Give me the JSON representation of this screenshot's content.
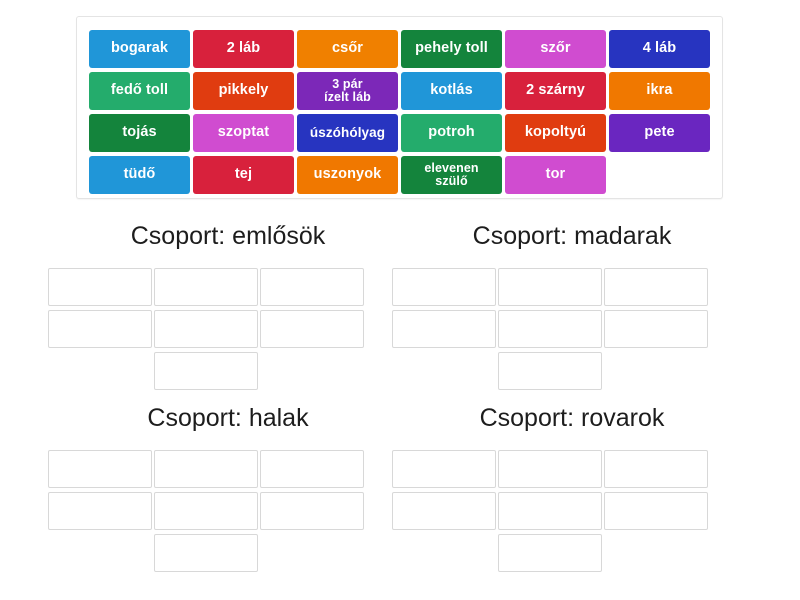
{
  "word_bank": {
    "tiles": [
      {
        "label": "bogarak",
        "color": "#2096d8",
        "lines": 1
      },
      {
        "label": "2 láb",
        "color": "#d8213c",
        "lines": 1
      },
      {
        "label": "csőr",
        "color": "#f08000",
        "lines": 1
      },
      {
        "label": "pehely toll",
        "color": "#14843c",
        "lines": 1
      },
      {
        "label": "szőr",
        "color": "#d04cd0",
        "lines": 1
      },
      {
        "label": "4 láb",
        "color": "#2734c0",
        "lines": 1
      },
      {
        "label": "fedő toll",
        "color": "#24ac6c",
        "lines": 1
      },
      {
        "label": "pikkely",
        "color": "#e03c10",
        "lines": 1
      },
      {
        "label": "3 pár ízelt láb",
        "color": "#7c28b8",
        "lines": 2,
        "line1": "3 pár",
        "line2": "ízelt láb"
      },
      {
        "label": "kotlás",
        "color": "#2096d8",
        "lines": 1
      },
      {
        "label": "2 szárny",
        "color": "#d8213c",
        "lines": 1
      },
      {
        "label": "ikra",
        "color": "#f07800",
        "lines": 1
      },
      {
        "label": "tojás",
        "color": "#14843c",
        "lines": 1
      },
      {
        "label": "szoptat",
        "color": "#d04cd0",
        "lines": 1
      },
      {
        "label": "úszóhólyag",
        "color": "#2734c0",
        "lines": 1,
        "shrink": true
      },
      {
        "label": "potroh",
        "color": "#24ac6c",
        "lines": 1
      },
      {
        "label": "kopoltyú",
        "color": "#e03c10",
        "lines": 1
      },
      {
        "label": "pete",
        "color": "#6a26c0",
        "lines": 1
      },
      {
        "label": "tüdő",
        "color": "#2096d8",
        "lines": 1
      },
      {
        "label": "tej",
        "color": "#d8213c",
        "lines": 1
      },
      {
        "label": "uszonyok",
        "color": "#f07800",
        "lines": 1
      },
      {
        "label": "elevenen szülő",
        "color": "#14843c",
        "lines": 2,
        "line1": "elevenen",
        "line2": "szülő"
      },
      {
        "label": "tor",
        "color": "#d04cd0",
        "lines": 1
      },
      {
        "label": "",
        "color": "transparent",
        "lines": 0
      }
    ]
  },
  "groups": [
    {
      "title": "Csoport: emlősök",
      "slot_count": 7,
      "slots": [
        "",
        "",
        "",
        "",
        "",
        "",
        ""
      ]
    },
    {
      "title": "Csoport: madarak",
      "slot_count": 7,
      "slots": [
        "",
        "",
        "",
        "",
        "",
        "",
        ""
      ]
    },
    {
      "title": "Csoport: halak",
      "slot_count": 7,
      "slots": [
        "",
        "",
        "",
        "",
        "",
        "",
        ""
      ]
    },
    {
      "title": "Csoport: rovarok",
      "slot_count": 7,
      "slots": [
        "",
        "",
        "",
        "",
        "",
        "",
        ""
      ]
    }
  ],
  "colors": {
    "blue": "#2096d8",
    "red": "#d8213c",
    "orange": "#f07800",
    "dark_green": "#14843c",
    "magenta": "#d04cd0",
    "navy": "#2734c0",
    "green": "#24ac6c",
    "red_orange": "#e03c10",
    "purple": "#7c28b8",
    "violet": "#6a26c0",
    "slot_border": "#d8d8d8",
    "panel_border": "#e4e4e4",
    "title_text": "#1d1d1d"
  }
}
